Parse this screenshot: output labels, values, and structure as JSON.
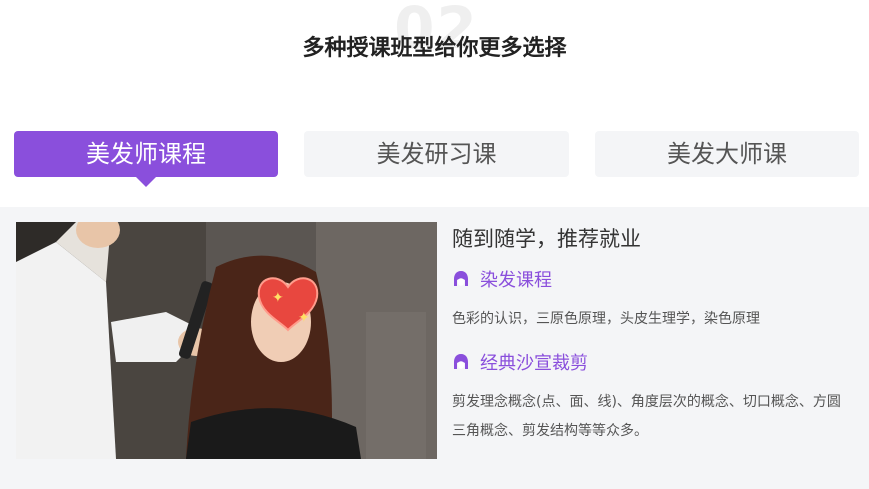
{
  "section": {
    "number": "02",
    "title": "多种授课班型给你更多选择"
  },
  "tabs": [
    {
      "label": "美发师课程",
      "active": true
    },
    {
      "label": "美发研习课",
      "active": false
    },
    {
      "label": "美发大师课",
      "active": false
    }
  ],
  "panel": {
    "headline": "随到随学，推荐就业",
    "courses": [
      {
        "name": "染发课程",
        "icon": "hair-head-icon",
        "description": "色彩的认识，三原色原理，头皮生理学，染色原理"
      },
      {
        "name": "经典沙宣裁剪",
        "icon": "hair-head-icon",
        "description": "剪发理念概念(点、面、线)、角度层次的概念、切口概念、方圆三角概念、剪发结构等等众多。"
      }
    ]
  },
  "colors": {
    "accent": "#8a4fdc",
    "tab_bg": "#f4f5f7",
    "panel_bg": "#f4f5f7"
  }
}
